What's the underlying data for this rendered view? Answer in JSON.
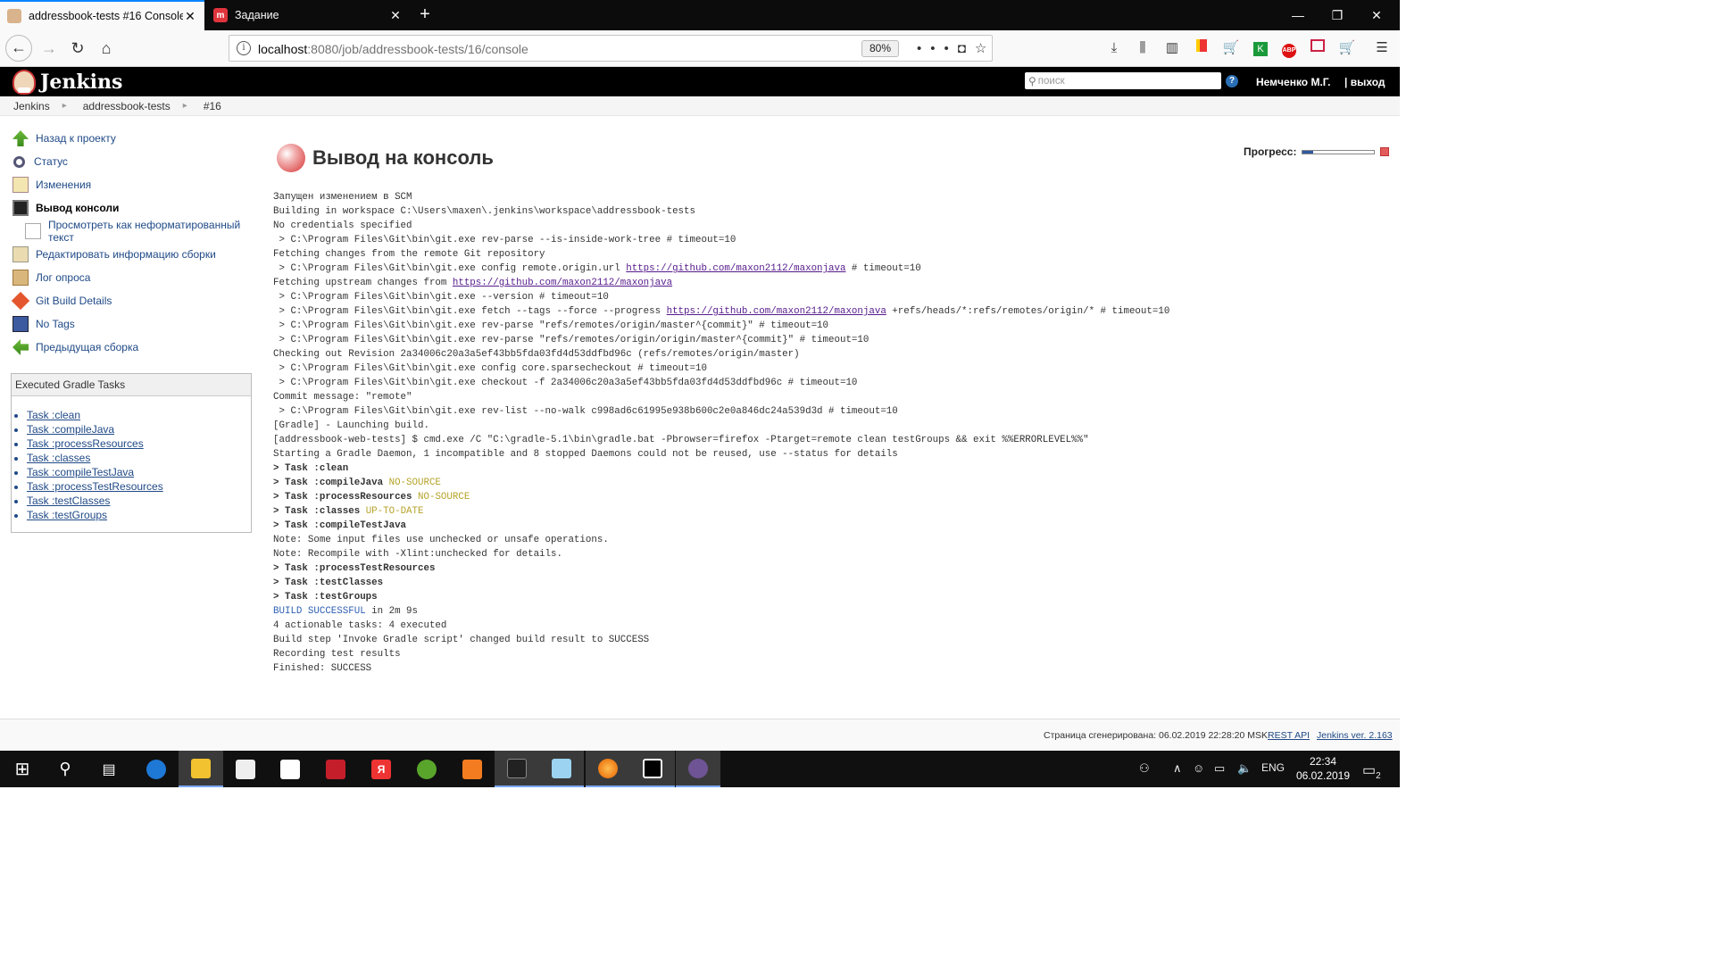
{
  "browser": {
    "tabs": [
      {
        "title": "addressbook-tests #16 Console",
        "active": true
      },
      {
        "title": "Задание",
        "active": false
      }
    ],
    "url_host": "localhost",
    "url_path": ":8080/job/addressbook-tests/16/console",
    "zoom": "80%"
  },
  "jenkins": {
    "logo_text": "Jenkins",
    "search_placeholder": "поиск",
    "user": "Немченко М.Г.",
    "logout": "| выход"
  },
  "breadcrumbs": [
    "Jenkins",
    "addressbook-tests",
    "#16"
  ],
  "sidebar": {
    "tasks": [
      {
        "label": "Назад к проекту",
        "icon": "arrow-up-icon"
      },
      {
        "label": "Статус",
        "icon": "search-icon"
      },
      {
        "label": "Изменения",
        "icon": "notepad-icon"
      },
      {
        "label": "Вывод консоли",
        "icon": "terminal-icon",
        "current": true
      },
      {
        "label": "Просмотреть как неформатированный текст",
        "icon": "document-icon",
        "sub": true
      },
      {
        "label": "Редактировать информацию сборки",
        "icon": "edit-icon"
      },
      {
        "label": "Лог опроса",
        "icon": "clipboard-icon"
      },
      {
        "label": "Git Build Details",
        "icon": "git-icon"
      },
      {
        "label": "No Tags",
        "icon": "save-icon"
      },
      {
        "label": "Предыдущая сборка",
        "icon": "arrow-left-icon"
      }
    ],
    "gradle_title": "Executed Gradle Tasks",
    "gradle_tasks": [
      "Task :clean",
      "Task :compileJava",
      "Task :processResources",
      "Task :classes",
      "Task :compileTestJava",
      "Task :processTestResources",
      "Task :testClasses",
      "Task :testGroups"
    ]
  },
  "main": {
    "title": "Вывод на консоль",
    "progress_label": "Прогресс:",
    "progress_fraction": 0.15,
    "console_lines": [
      "Запущен изменением в SCM",
      "Building in workspace C:\\Users\\maxen\\.jenkins\\workspace\\addressbook-tests",
      "No credentials specified",
      " > C:\\Program Files\\Git\\bin\\git.exe rev-parse --is-inside-work-tree # timeout=10",
      "Fetching changes from the remote Git repository",
      " > C:\\Program Files\\Git\\bin\\git.exe config remote.origin.url https://github.com/maxon2112/maxonjava # timeout=10",
      "Fetching upstream changes from https://github.com/maxon2112/maxonjava",
      " > C:\\Program Files\\Git\\bin\\git.exe --version # timeout=10",
      " > C:\\Program Files\\Git\\bin\\git.exe fetch --tags --force --progress https://github.com/maxon2112/maxonjava +refs/heads/*:refs/remotes/origin/* # timeout=10",
      " > C:\\Program Files\\Git\\bin\\git.exe rev-parse \"refs/remotes/origin/master^{commit}\" # timeout=10",
      " > C:\\Program Files\\Git\\bin\\git.exe rev-parse \"refs/remotes/origin/origin/master^{commit}\" # timeout=10",
      "Checking out Revision 2a34006c20a3a5ef43bb5fda03fd4d53ddfbd96c (refs/remotes/origin/master)",
      " > C:\\Program Files\\Git\\bin\\git.exe config core.sparsecheckout # timeout=10",
      " > C:\\Program Files\\Git\\bin\\git.exe checkout -f 2a34006c20a3a5ef43bb5fda03fd4d53ddfbd96c # timeout=10",
      "Commit message: \"remote\"",
      " > C:\\Program Files\\Git\\bin\\git.exe rev-list --no-walk c998ad6c61995e938b600c2e0a846dc24a539d3d # timeout=10",
      "[Gradle] - Launching build.",
      "[addressbook-web-tests] $ cmd.exe /C \"C:\\gradle-5.1\\bin\\gradle.bat -Pbrowser=firefox -Ptarget=remote clean testGroups && exit %%ERRORLEVEL%%\"",
      "Starting a Gradle Daemon, 1 incompatible and 8 stopped Daemons could not be reused, use --status for details",
      "> Task :clean",
      "> Task :compileJava NO-SOURCE",
      "> Task :processResources NO-SOURCE",
      "> Task :classes UP-TO-DATE",
      "> Task :compileTestJava",
      "Note: Some input files use unchecked or unsafe operations.",
      "Note: Recompile with -Xlint:unchecked for details.",
      "> Task :processTestResources",
      "> Task :testClasses",
      "> Task :testGroups",
      "BUILD SUCCESSFUL in 2m 9s",
      "4 actionable tasks: 4 executed",
      "Build step 'Invoke Gradle script' changed build result to SUCCESS",
      "Recording test results",
      "Finished: SUCCESS"
    ]
  },
  "footer": {
    "generated": "Страница сгенерирована: 06.02.2019 22:28:20 MSK",
    "rest_api": "REST API",
    "version": "Jenkins ver. 2.163"
  },
  "taskbar": {
    "lang": "ENG",
    "time": "22:34",
    "date": "06.02.2019",
    "notifications": "2"
  }
}
